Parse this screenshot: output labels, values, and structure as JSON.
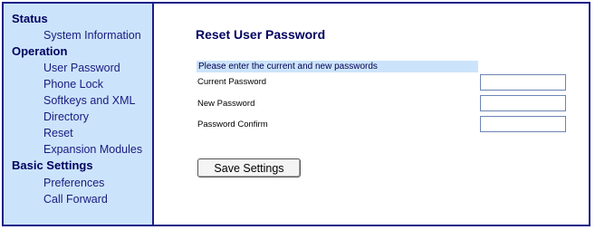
{
  "sidebar": {
    "sections": [
      {
        "title": "Status",
        "items": [
          "System Information"
        ]
      },
      {
        "title": "Operation",
        "items": [
          "User Password",
          "Phone Lock",
          "Softkeys and XML",
          "Directory",
          "Reset",
          "Expansion Modules"
        ]
      },
      {
        "title": "Basic Settings",
        "items": [
          "Preferences",
          "Call Forward"
        ]
      }
    ]
  },
  "main": {
    "title": "Reset User Password",
    "prompt": "Please enter the current and new passwords",
    "fields": [
      {
        "label": "Current Password",
        "value": "",
        "placeholder": ""
      },
      {
        "label": "New Password",
        "value": "",
        "placeholder": ""
      },
      {
        "label": "Password Confirm",
        "value": "",
        "placeholder": ""
      }
    ],
    "save_label": "Save Settings"
  }
}
